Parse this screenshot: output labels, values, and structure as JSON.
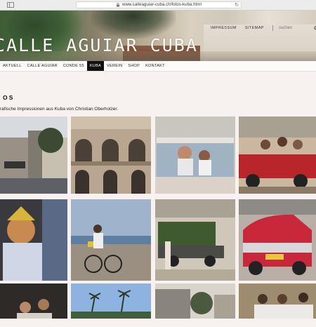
{
  "browser": {
    "url": "www.calleaguiar-cuba.ch/fotos-kuba.html"
  },
  "header": {
    "site_title": "CALLE AGUIAR CUBA",
    "top_links": [
      "IMPRESSUM",
      "SITEMAP"
    ],
    "search_placeholder": "suchen"
  },
  "nav": {
    "items": [
      {
        "label": "AKTUELL",
        "active": false
      },
      {
        "label": "CALLE AGUIAR",
        "active": false
      },
      {
        "label": "CONDE 55",
        "active": false
      },
      {
        "label": "KUBA",
        "active": true
      },
      {
        "label": "VEREIN",
        "active": false
      },
      {
        "label": "SHOP",
        "active": false
      },
      {
        "label": "KONTAKT",
        "active": false
      }
    ]
  },
  "main": {
    "title": "OS",
    "intro": "rafische Impressionen aus Kuba von Christian Oberholzer."
  },
  "colors": {
    "active_nav_bg": "#111111",
    "page_bg": "#f7f2f0"
  }
}
